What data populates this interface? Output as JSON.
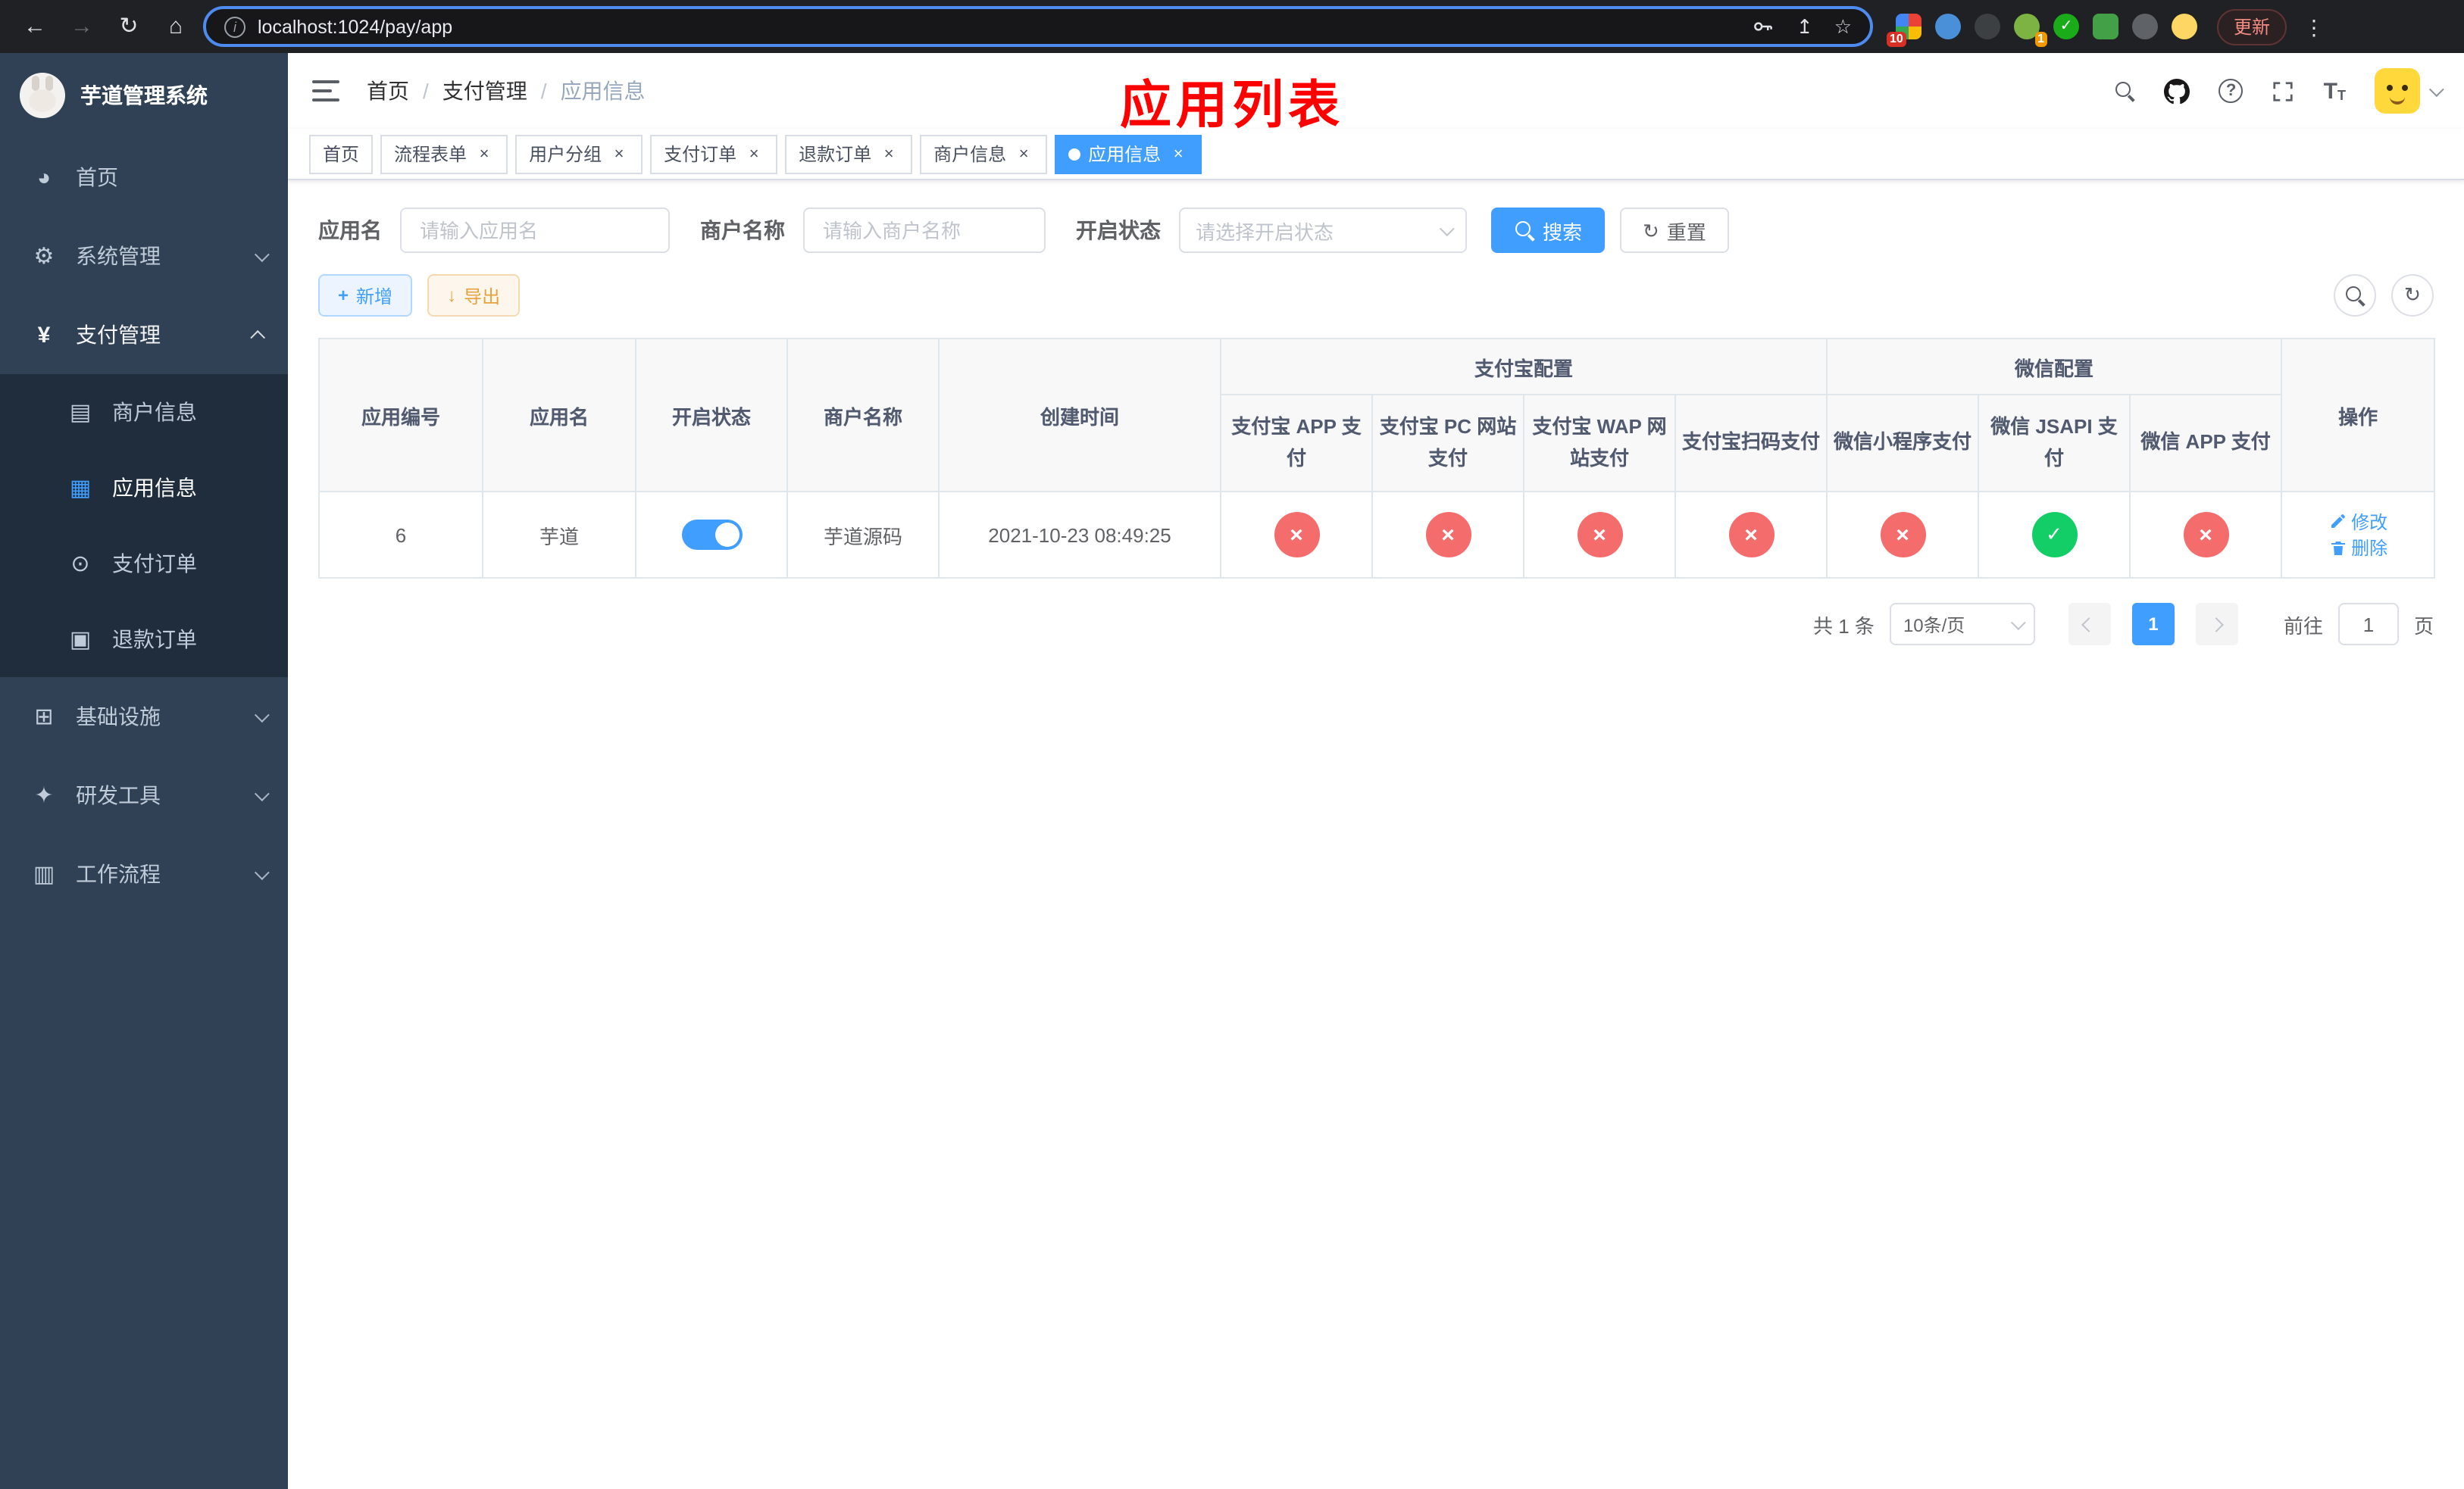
{
  "browser": {
    "url": "localhost:1024/pay/app",
    "update_label": "更新",
    "badges": [
      "10",
      "1"
    ]
  },
  "sidebar": {
    "app_title": "芋道管理系统",
    "items": [
      {
        "label": "首页"
      },
      {
        "label": "系统管理"
      },
      {
        "label": "支付管理"
      },
      {
        "label": "商户信息"
      },
      {
        "label": "应用信息"
      },
      {
        "label": "支付订单"
      },
      {
        "label": "退款订单"
      },
      {
        "label": "基础设施"
      },
      {
        "label": "研发工具"
      },
      {
        "label": "工作流程"
      }
    ]
  },
  "header": {
    "breadcrumb": [
      "首页",
      "支付管理",
      "应用信息"
    ],
    "overlay_title": "应用列表"
  },
  "tabs": [
    {
      "label": "首页"
    },
    {
      "label": "流程表单"
    },
    {
      "label": "用户分组"
    },
    {
      "label": "支付订单"
    },
    {
      "label": "退款订单"
    },
    {
      "label": "商户信息"
    },
    {
      "label": "应用信息"
    }
  ],
  "filters": {
    "app_name_label": "应用名",
    "app_name_placeholder": "请输入应用名",
    "merchant_label": "商户名称",
    "merchant_placeholder": "请输入商户名称",
    "status_label": "开启状态",
    "status_placeholder": "请选择开启状态",
    "search_label": "搜索",
    "reset_label": "重置"
  },
  "toolbar": {
    "add_label": "新增",
    "export_label": "导出"
  },
  "table": {
    "main_columns": [
      "应用编号",
      "应用名",
      "开启状态",
      "商户名称",
      "创建时间"
    ],
    "alipay_group": "支付宝配置",
    "wechat_group": "微信配置",
    "pay_columns": [
      "支付宝 APP 支付",
      "支付宝 PC 网站支付",
      "支付宝 WAP 网站支付",
      "支付宝扫码支付",
      "微信小程序支付",
      "微信 JSAPI 支付",
      "微信 APP 支付"
    ],
    "actions_column": "操作",
    "rows": [
      {
        "id": "6",
        "name": "芋道",
        "enabled": true,
        "merchant": "芋道源码",
        "created_at": "2021-10-23 08:49:25",
        "pay_status": [
          "fail",
          "fail",
          "fail",
          "fail",
          "fail",
          "success",
          "fail"
        ],
        "edit_label": "修改",
        "delete_label": "删除"
      }
    ]
  },
  "pagination": {
    "total": "共 1 条",
    "page_size": "10条/页",
    "page": "1",
    "goto_label": "前往",
    "goto_value": "1",
    "unit_label": "页"
  },
  "colors": {
    "primary": "#409eff",
    "success": "#13ce66",
    "danger": "#f56c6c",
    "warning": "#e6a23c",
    "sidebar_bg": "#304156",
    "submenu_bg": "#1f2d3d",
    "overlay_title": "#ff0000"
  }
}
